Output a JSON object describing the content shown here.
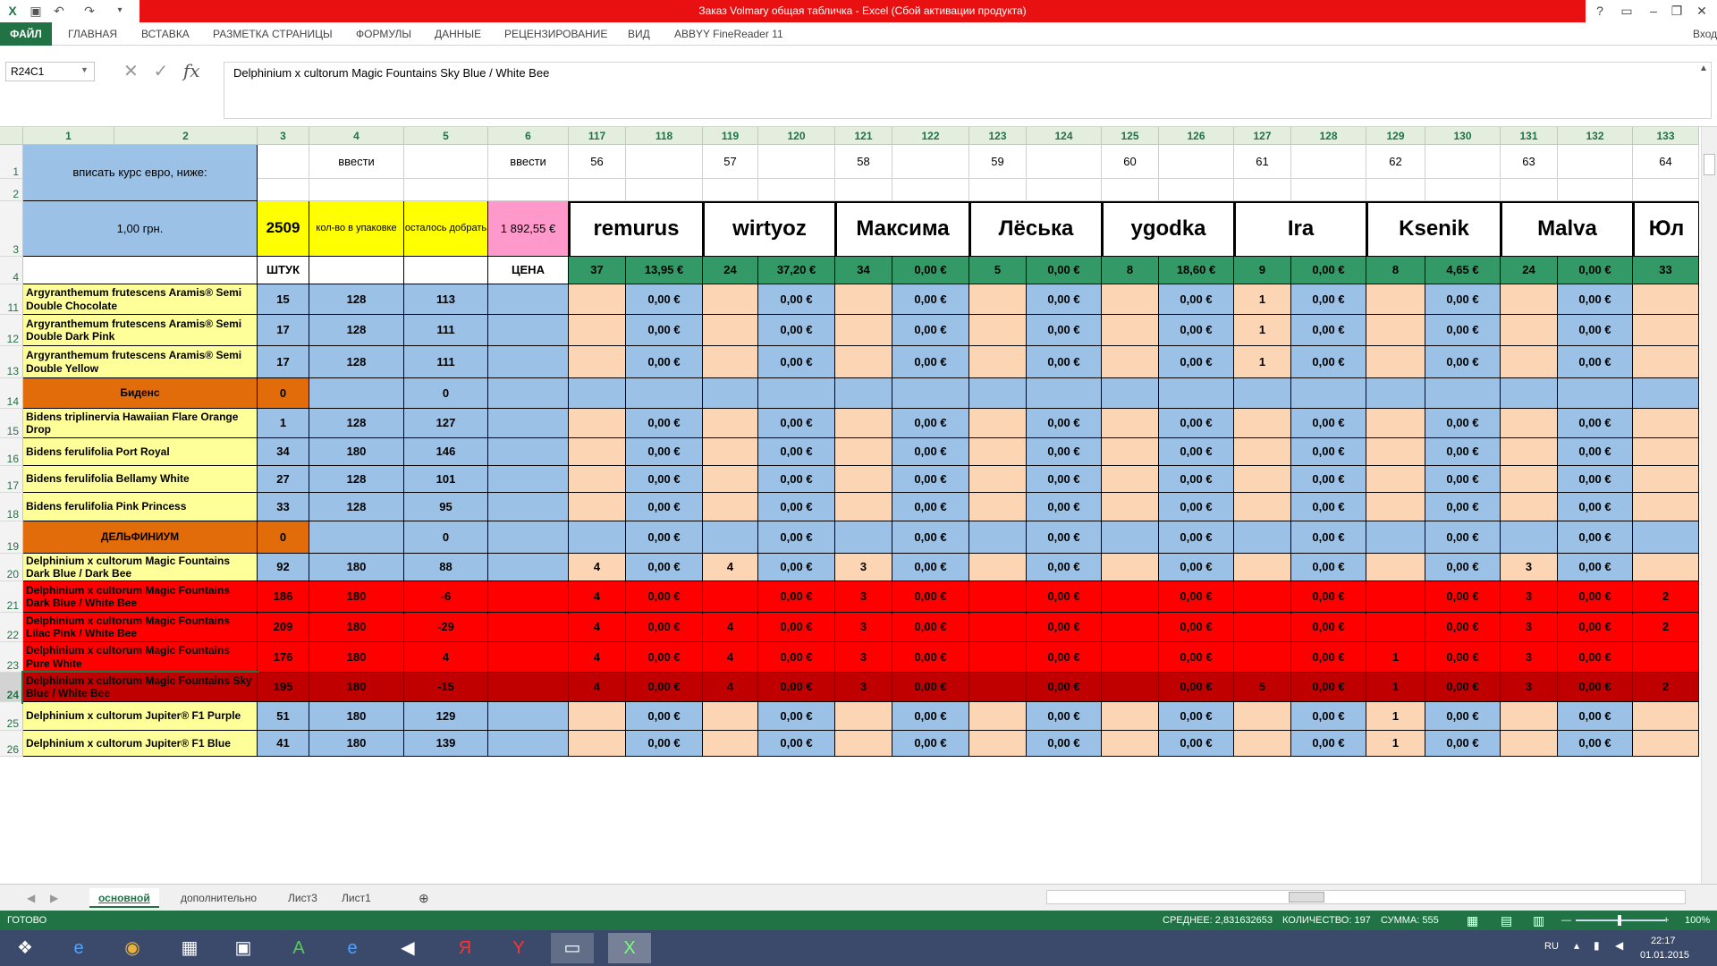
{
  "title": "Заказ Volmary общая табличка -  Excel (Сбой активации продукта)",
  "ribbon": {
    "file": "ФАЙЛ",
    "tabs": [
      "ГЛАВНАЯ",
      "ВСТАВКА",
      "РАЗМЕТКА СТРАНИЦЫ",
      "ФОРМУЛЫ",
      "ДАННЫЕ",
      "РЕЦЕНЗИРОВАНИЕ",
      "ВИД",
      "ABBYY FineReader 11"
    ],
    "signin": "Вход"
  },
  "namebox": "R24C1",
  "formula": "Delphinium x cultorum Magic Fountains Sky Blue / White Bee",
  "colheaders": [
    "1",
    "2",
    "3",
    "4",
    "5",
    "6",
    "117",
    "118",
    "119",
    "120",
    "121",
    "122",
    "123",
    "124",
    "125",
    "126",
    "127",
    "128",
    "129",
    "130",
    "131",
    "132",
    "133"
  ],
  "r1": {
    "label": "вписать курс евро, ниже:",
    "c4": "ввести",
    "c6": "ввести",
    "nums": [
      "56",
      "57",
      "58",
      "59",
      "60",
      "61",
      "62",
      "63",
      "64"
    ]
  },
  "r3": {
    "rate": "1,00 грн.",
    "total": "2509",
    "pack": "кол-во в упаковке",
    "left": "осталось добрать",
    "sum": "1 892,55 €",
    "names": [
      "remurus",
      "wirtyoz",
      "Максима",
      "Лёська",
      "ygodka",
      "Ira",
      "Ksenik",
      "Malva",
      "Юл"
    ]
  },
  "r4": {
    "c3": "ШТУК",
    "c6": "ЦЕНА",
    "vals": [
      "37",
      "13,95 €",
      "24",
      "37,20 €",
      "34",
      "0,00 €",
      "5",
      "0,00 €",
      "8",
      "18,60 €",
      "9",
      "0,00 €",
      "8",
      "4,65 €",
      "24",
      "0,00 €",
      "33"
    ]
  },
  "rows": [
    {
      "n": "11",
      "name": "Argyranthemum frutescens Aramis® Semi Double Chocolate",
      "a": "15",
      "b": "128",
      "c": "113",
      "q": [
        "",
        "",
        "",
        "",
        "",
        "1",
        "",
        "",
        ""
      ],
      "e": "0,00 €",
      "cls": "y"
    },
    {
      "n": "12",
      "name": "Argyranthemum frutescens Aramis® Semi Double Dark Pink",
      "a": "17",
      "b": "128",
      "c": "111",
      "q": [
        "",
        "",
        "",
        "",
        "",
        "1",
        "",
        "",
        ""
      ],
      "e": "0,00 €",
      "cls": "y"
    },
    {
      "n": "13",
      "name": "Argyranthemum frutescens Aramis® Semi Double Yellow",
      "a": "17",
      "b": "128",
      "c": "111",
      "q": [
        "",
        "",
        "",
        "",
        "",
        "1",
        "",
        "",
        ""
      ],
      "e": "0,00 €",
      "cls": "y"
    },
    {
      "n": "14",
      "name": "Биденс",
      "a": "0",
      "b": "",
      "c": "0",
      "q": [
        "",
        "",
        "",
        "",
        "",
        "",
        "",
        "",
        ""
      ],
      "e": "",
      "cls": "h"
    },
    {
      "n": "15",
      "name": "Bidens triplinervia Hawaiian Flare Orange Drop",
      "a": "1",
      "b": "128",
      "c": "127",
      "q": [
        "",
        "",
        "",
        "",
        "",
        "",
        "",
        "",
        ""
      ],
      "e": "0,00 €",
      "cls": "y"
    },
    {
      "n": "16",
      "name": "Bidens ferulifolia Port Royal",
      "a": "34",
      "b": "180",
      "c": "146",
      "q": [
        "",
        "",
        "",
        "",
        "",
        "",
        "",
        "",
        ""
      ],
      "e": "0,00 €",
      "cls": "y"
    },
    {
      "n": "17",
      "name": "Bidens ferulifolia Bellamy White",
      "a": "27",
      "b": "128",
      "c": "101",
      "q": [
        "",
        "",
        "",
        "",
        "",
        "",
        "",
        "",
        ""
      ],
      "e": "0,00 €",
      "cls": "y"
    },
    {
      "n": "18",
      "name": "Bidens ferulifolia Pink Princess",
      "a": "33",
      "b": "128",
      "c": "95",
      "q": [
        "",
        "",
        "",
        "",
        "",
        "",
        "",
        "",
        ""
      ],
      "e": "0,00 €",
      "cls": "y"
    },
    {
      "n": "19",
      "name": "ДЕЛЬФИНИУМ",
      "a": "0",
      "b": "",
      "c": "0",
      "q": [
        "",
        "",
        "",
        "",
        "",
        "",
        "",
        "",
        ""
      ],
      "e": "0,00 €",
      "cls": "h"
    },
    {
      "n": "20",
      "name": "Delphinium x cultorum Magic Fountains Dark Blue / Dark Bee",
      "a": "92",
      "b": "180",
      "c": "88",
      "q": [
        "4",
        "4",
        "3",
        "",
        "",
        "",
        "",
        "3",
        ""
      ],
      "e": "0,00 €",
      "cls": "y"
    },
    {
      "n": "21",
      "name": "Delphinium x cultorum Magic Fountains Dark Blue / White Bee",
      "a": "186",
      "b": "180",
      "c": "-6",
      "q": [
        "4",
        "",
        "3",
        "",
        "",
        "",
        "",
        "3",
        "2"
      ],
      "e": "0,00 €",
      "cls": "r"
    },
    {
      "n": "22",
      "name": "Delphinium x cultorum Magic Fountains Lilac Pink / White Bee",
      "a": "209",
      "b": "180",
      "c": "-29",
      "q": [
        "4",
        "4",
        "3",
        "",
        "",
        "",
        "",
        "3",
        "2"
      ],
      "e": "0,00 €",
      "cls": "r"
    },
    {
      "n": "23",
      "name": "Delphinium x cultorum Magic Fountains Pure White",
      "a": "176",
      "b": "180",
      "c": "4",
      "q": [
        "4",
        "4",
        "3",
        "",
        "",
        "",
        "1",
        "3",
        ""
      ],
      "e": "0,00 €",
      "cls": "r"
    },
    {
      "n": "24",
      "name": "Delphinium x cultorum Magic Fountains Sky Blue / White Bee",
      "a": "195",
      "b": "180",
      "c": "-15",
      "q": [
        "4",
        "4",
        "3",
        "",
        "",
        "5",
        "1",
        "3",
        "2"
      ],
      "e": "0,00 €",
      "cls": "dr"
    },
    {
      "n": "25",
      "name": "Delphinium x cultorum Jupiter® F1 Purple",
      "a": "51",
      "b": "180",
      "c": "129",
      "q": [
        "",
        "",
        "",
        "",
        "",
        "",
        "1",
        "",
        ""
      ],
      "e": "0,00 €",
      "cls": "y"
    },
    {
      "n": "26",
      "name": "Delphinium x cultorum Jupiter® F1 Blue",
      "a": "41",
      "b": "180",
      "c": "139",
      "q": [
        "",
        "",
        "",
        "",
        "",
        "",
        "1",
        "",
        ""
      ],
      "e": "0,00 €",
      "cls": "y"
    }
  ],
  "sheets": [
    "основной",
    "дополнительно",
    "Лист3",
    "Лист1"
  ],
  "status": {
    "ready": "ГОТОВО",
    "avg": "СРЕДНЕЕ: 2,831632653",
    "count": "КОЛИЧЕСТВО: 197",
    "sum": "СУММА: 555",
    "zoom": "100%"
  },
  "clock": {
    "time": "22:17",
    "date": "01.01.2015",
    "lang": "RU"
  },
  "colors": {
    "excel": "#217346",
    "title": "#e81010",
    "yellow": "#ffff99",
    "blue": "#9bc2e6",
    "peach": "#fcd5b4",
    "green": "#339966",
    "orange": "#e26b0a",
    "red": "#ff0000",
    "darkred": "#c00000",
    "pink": "#ff99cc",
    "cyan": "#ffff00"
  }
}
